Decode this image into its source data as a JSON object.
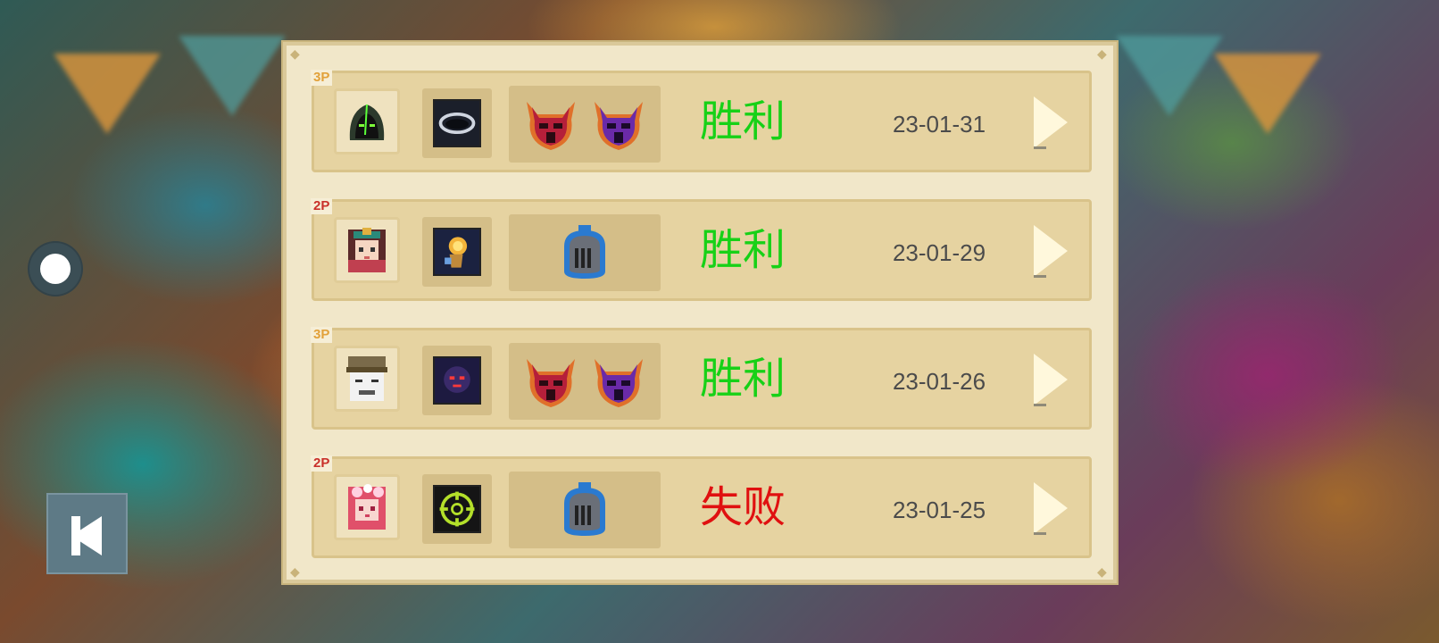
{
  "records": [
    {
      "players_badge": "3P",
      "hero_icon": "hooded-assassin-icon",
      "weapon_icon": "dark-ring-blade-icon",
      "bosses": [
        "red-demon-helmet-icon",
        "purple-demon-helmet-icon"
      ],
      "result": "胜利",
      "result_type": "win",
      "date": "23-01-31"
    },
    {
      "players_badge": "2P",
      "hero_icon": "priestess-girl-icon",
      "weapon_icon": "golden-torch-hand-icon",
      "bosses": [
        "blue-knight-helmet-icon"
      ],
      "result": "胜利",
      "result_type": "win",
      "date": "23-01-29"
    },
    {
      "players_badge": "3P",
      "hero_icon": "meme-face-hat-icon",
      "weapon_icon": "red-eye-creature-icon",
      "bosses": [
        "red-demon-helmet-icon",
        "purple-demon-helmet-icon"
      ],
      "result": "胜利",
      "result_type": "win",
      "date": "23-01-26"
    },
    {
      "players_badge": "2P",
      "hero_icon": "pink-flower-girl-icon",
      "weapon_icon": "green-target-scope-icon",
      "bosses": [
        "blue-knight-helmet-icon"
      ],
      "result": "失败",
      "result_type": "lose",
      "date": "23-01-25"
    }
  ],
  "colors": {
    "win": "#17d117",
    "lose": "#e01010",
    "panel_bg": "#f1e7c9",
    "row_bg": "#e6d3a1",
    "badge_3p": "#e2a13a",
    "badge_2p": "#c9302a"
  }
}
